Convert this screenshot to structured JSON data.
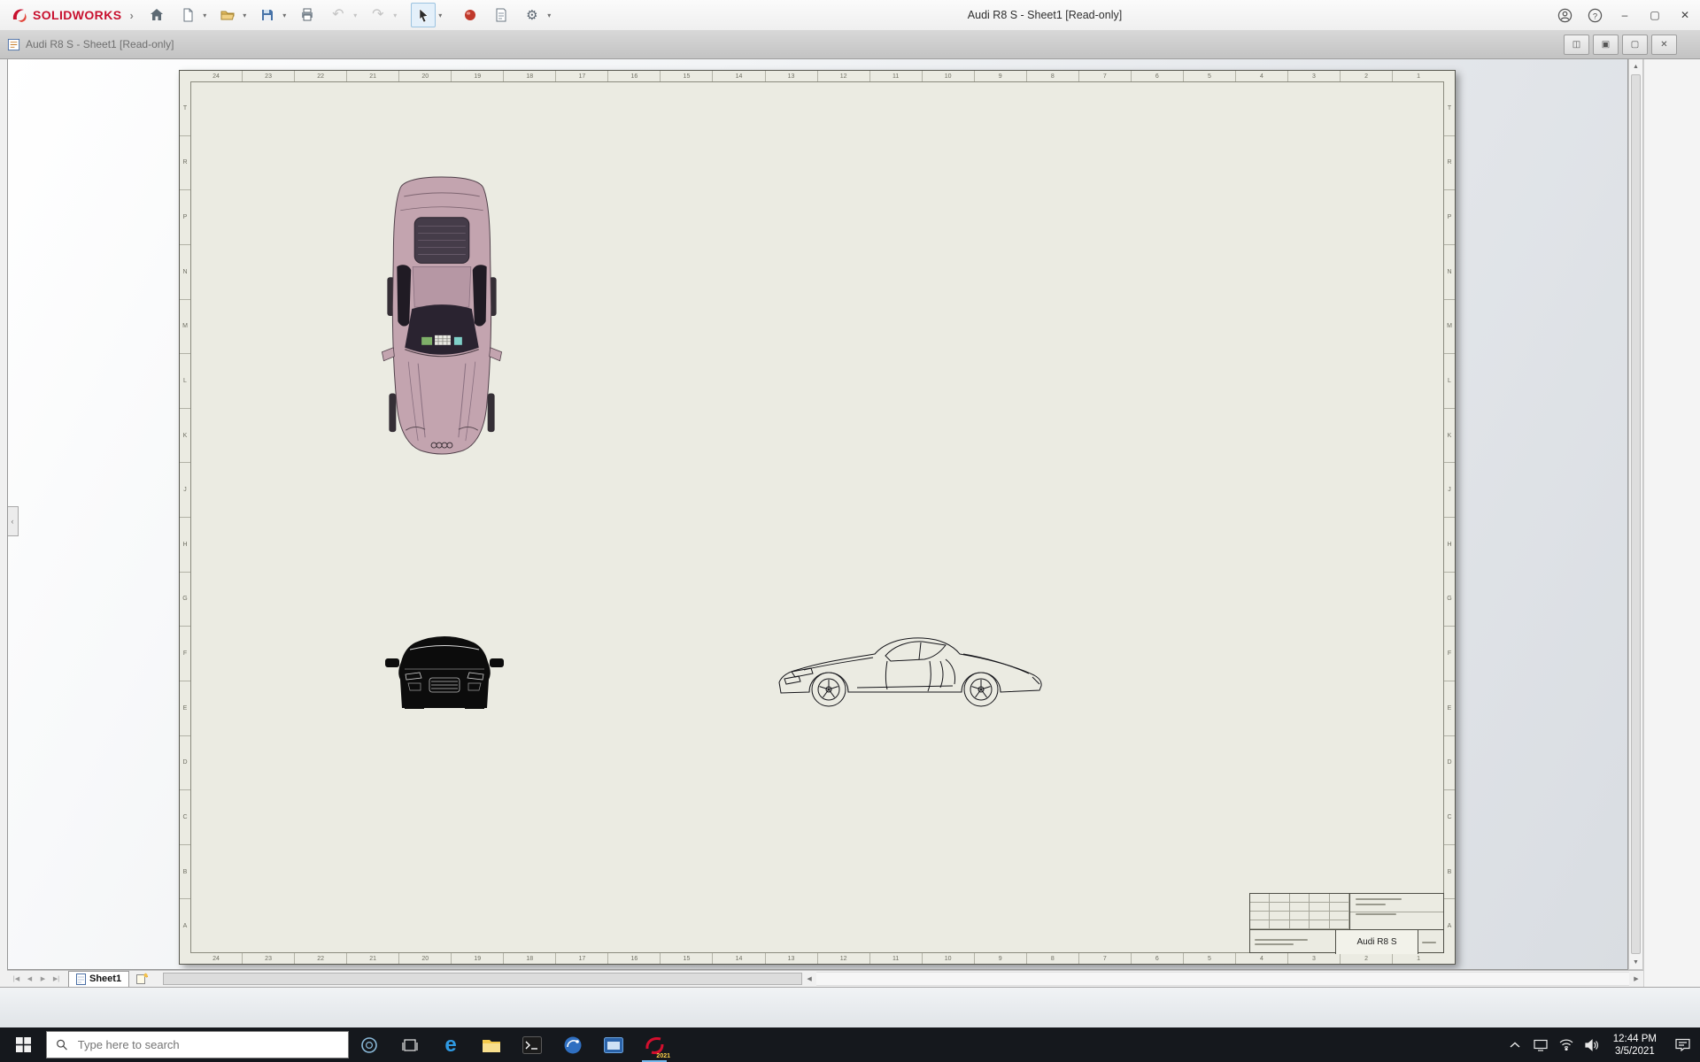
{
  "app": {
    "brand": "SOLIDWORKS",
    "title": "Audi R8 S - Sheet1 [Read-only]",
    "toolbar_icons": [
      "home-icon",
      "new-document-icon",
      "open-folder-icon",
      "save-icon",
      "print-icon",
      "undo-icon",
      "redo-icon",
      "select-cursor-icon",
      "appearance-sphere-icon",
      "file-properties-icon",
      "options-gear-icon"
    ],
    "window_controls": [
      "account-icon",
      "help-icon",
      "minimize-icon",
      "maximize-icon",
      "close-icon"
    ]
  },
  "document_window": {
    "title": "Audi R8 S - Sheet1 [Read-only]",
    "control_glyphs": [
      "◫",
      "▣",
      "▢",
      "✕"
    ]
  },
  "glyphs": {
    "logo_sep": "›",
    "caret_down": "▾",
    "undo": "↶",
    "redo": "↷",
    "gear": "⚙",
    "help": "?",
    "minimize": "–",
    "maximize": "▢",
    "close": "✕",
    "chevron_left": "‹",
    "up": "▲",
    "down": "▼",
    "left": "◀",
    "right": "▶",
    "nav_first": "|◀",
    "nav_prev": "◀",
    "nav_next": "▶",
    "nav_last": "▶|"
  },
  "sheet": {
    "zone_columns": [
      "24",
      "23",
      "22",
      "21",
      "20",
      "19",
      "18",
      "17",
      "16",
      "15",
      "14",
      "13",
      "12",
      "11",
      "10",
      "9",
      "8",
      "7",
      "6",
      "5",
      "4",
      "3",
      "2",
      "1"
    ],
    "zone_rows": [
      "T",
      "R",
      "P",
      "N",
      "M",
      "L",
      "K",
      "J",
      "H",
      "G",
      "F",
      "E",
      "D",
      "C",
      "B",
      "A"
    ],
    "views": [
      "top-view",
      "front-view",
      "side-view"
    ],
    "title_block": {
      "model_name": "Audi R8 S"
    }
  },
  "sheet_bar": {
    "tab_label": "Sheet1"
  },
  "taskbar": {
    "search_placeholder": "Type here to search",
    "app_icons": [
      "start-icon",
      "cortana-icon",
      "task-view-icon",
      "edge-icon",
      "file-explorer-icon",
      "console-icon",
      "3dexperience-icon",
      "app-window-icon",
      "solidworks-icon"
    ],
    "solidworks_badge": "2021",
    "tray": {
      "time": "12:44 PM",
      "date": "3/5/2021"
    }
  }
}
